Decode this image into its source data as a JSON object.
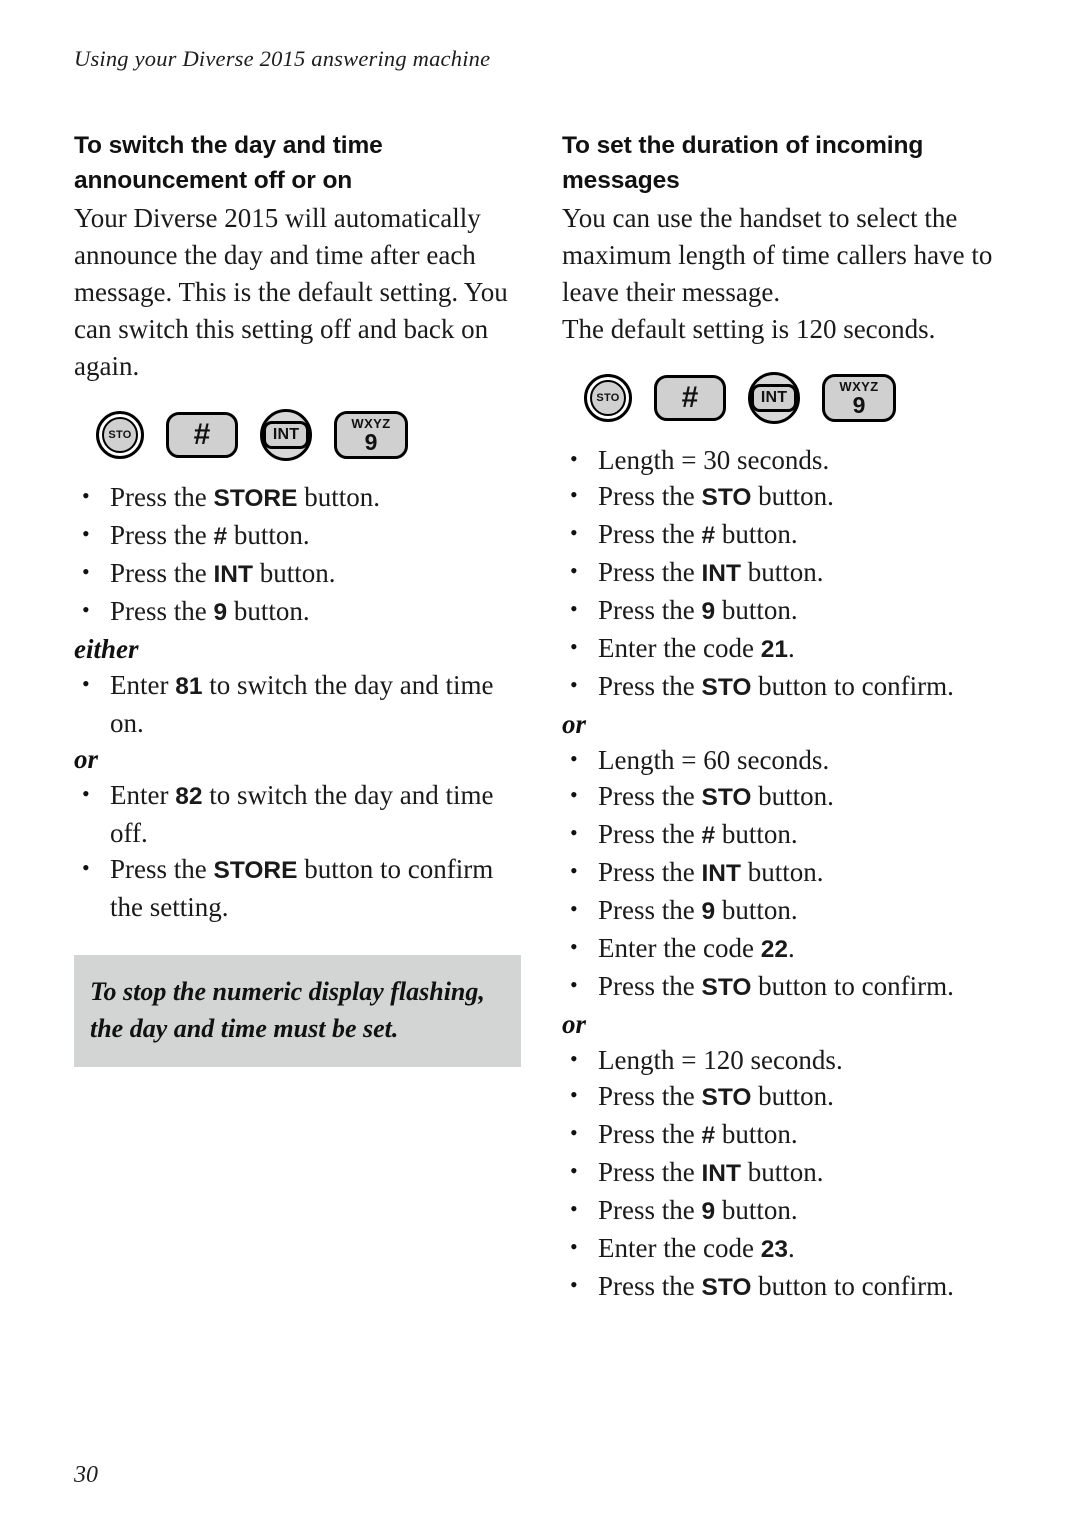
{
  "running_head": "Using your Diverse 2015 answering machine",
  "folio": "30",
  "keypad": {
    "sto_label": "STO",
    "hash_label": "#",
    "int_label": "INT",
    "num_letters": "WXYZ",
    "num_digit": "9"
  },
  "left_column": {
    "heading": "To switch the day and time announcement off or on",
    "intro": "Your Diverse 2015 will automatically announce the day and time after each message. This is the default setting. You can switch this setting off and back on again.",
    "steps": [
      {
        "pre": "Press the ",
        "kbd": "STORE",
        "post": " button."
      },
      {
        "pre": "Press the ",
        "kbd": "#",
        "post": " button."
      },
      {
        "pre": "Press the ",
        "kbd": "INT",
        "post": " button."
      },
      {
        "pre": "Press the ",
        "kbd": "9",
        "post": " button."
      }
    ],
    "connector_either": "either",
    "steps_either": [
      {
        "pre": "Enter ",
        "kbd": "81",
        "post": " to switch the day and time on."
      }
    ],
    "connector_or": "or",
    "steps_or": [
      {
        "pre": "Enter ",
        "kbd": "82",
        "post": " to switch the day and time off."
      },
      {
        "pre": "Press the ",
        "kbd": "STORE",
        "post": " button to confirm the setting."
      }
    ],
    "note": "To stop the numeric display flashing, the day and time must be set."
  },
  "right_column": {
    "heading": "To set the duration of incoming messages",
    "intro_1": "You can use the handset to select the maximum length of time callers have to leave their message.",
    "intro_2": "The default setting is 120 seconds.",
    "group_1": {
      "steps": [
        {
          "pre": "Length = 30 seconds.",
          "kbd": "",
          "post": ""
        },
        {
          "pre": "Press the ",
          "kbd": "STO",
          "post": " button."
        },
        {
          "pre": "Press the ",
          "kbd": "#",
          "post": " button."
        },
        {
          "pre": "Press the ",
          "kbd": "INT",
          "post": " button."
        },
        {
          "pre": "Press the ",
          "kbd": "9",
          "post": " button."
        },
        {
          "pre": "Enter the code ",
          "kbd": "21",
          "post": "."
        },
        {
          "pre": "Press the ",
          "kbd": "STO",
          "post": " button to confirm."
        }
      ]
    },
    "connector_or_1": "or",
    "group_2": {
      "steps": [
        {
          "pre": "Length = 60 seconds.",
          "kbd": "",
          "post": ""
        },
        {
          "pre": "Press the ",
          "kbd": "STO",
          "post": " button."
        },
        {
          "pre": "Press the ",
          "kbd": "#",
          "post": " button."
        },
        {
          "pre": "Press the ",
          "kbd": "INT",
          "post": " button."
        },
        {
          "pre": "Press the ",
          "kbd": "9",
          "post": " button."
        },
        {
          "pre": "Enter the code ",
          "kbd": "22",
          "post": "."
        },
        {
          "pre": "Press the ",
          "kbd": "STO",
          "post": " button to confirm."
        }
      ]
    },
    "connector_or_2": "or",
    "group_3": {
      "steps": [
        {
          "pre": "Length = 120 seconds.",
          "kbd": "",
          "post": ""
        },
        {
          "pre": "Press the ",
          "kbd": "STO",
          "post": " button."
        },
        {
          "pre": "Press the ",
          "kbd": "#",
          "post": " button."
        },
        {
          "pre": "Press the ",
          "kbd": "INT",
          "post": " button."
        },
        {
          "pre": "Press the ",
          "kbd": "9",
          "post": " button."
        },
        {
          "pre": "Enter the code ",
          "kbd": "23",
          "post": "."
        },
        {
          "pre": "Press the ",
          "kbd": "STO",
          "post": " button to confirm."
        }
      ]
    }
  },
  "colors": {
    "note_background": "#d3d4d4",
    "key_fill": "#d0d0d0",
    "text": "#1a1a1a"
  }
}
